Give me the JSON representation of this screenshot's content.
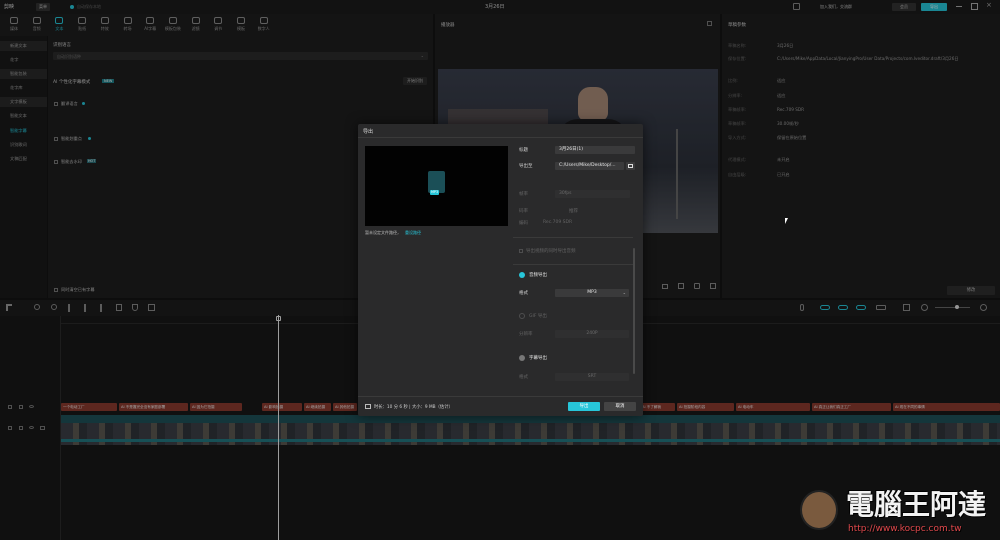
{
  "titlebar": {
    "app_name": "剪映",
    "menu_label": "菜单",
    "autosave": "自动保存本地",
    "project_title": "3月26日",
    "join_prompt": "加入我们，交流群",
    "account_label": "会员",
    "export_label": "导出"
  },
  "toolbar": {
    "items": [
      {
        "label": "媒体",
        "icon": "media-icon"
      },
      {
        "label": "音频",
        "icon": "audio-icon"
      },
      {
        "label": "文本",
        "icon": "text-icon"
      },
      {
        "label": "贴纸",
        "icon": "sticker-icon"
      },
      {
        "label": "特效",
        "icon": "effects-icon"
      },
      {
        "label": "转场",
        "icon": "transition-icon"
      },
      {
        "label": "AI字幕",
        "icon": "caption-icon"
      },
      {
        "label": "模板包装",
        "icon": "template-icon"
      },
      {
        "label": "滤镜",
        "icon": "filter-icon"
      },
      {
        "label": "调节",
        "icon": "adjust-icon"
      },
      {
        "label": "模板",
        "icon": "templates-icon"
      },
      {
        "label": "数字人",
        "icon": "avatar-icon"
      }
    ],
    "active_index": 2
  },
  "sidebar": {
    "items": [
      "新建文本",
      "花字",
      "智能包装",
      "花字库",
      "文字模板",
      "智能文本",
      "智能字幕",
      "识别歌词",
      "文稿匹配"
    ],
    "selected_index": 6
  },
  "caption_panel": {
    "header": "识别语言",
    "language_value": "自动识别语种",
    "ai_mode_label": "AI 个性化字幕模式",
    "ai_badge": "NEW",
    "option_1": "翻译语言",
    "option_2": "智能划重点",
    "option_3": "智能去水印",
    "option_3_badge": "HOT",
    "bottom_option": "同时清空已有字幕",
    "right_button": "开始识别"
  },
  "player": {
    "header": "播放器"
  },
  "details": {
    "header": "草稿参数",
    "rows": [
      {
        "label": "草稿名称:",
        "value": "3月26日"
      },
      {
        "label": "保存位置:",
        "value": "C:/Users/Mike/AppData/Local/JianyingPro/User Data/Projects/com.lveditor.draft/3月26日"
      },
      {
        "label": "比例:",
        "value": "适应"
      },
      {
        "label": "分辨率:",
        "value": "适应"
      },
      {
        "label": "草稿帧率:",
        "value": "Rec.709 SDR"
      },
      {
        "label": "草稿帧率:",
        "value": "30.00帧/秒"
      },
      {
        "label": "导入方式:",
        "value": "保留在原始位置"
      },
      {
        "label": "代理模式:",
        "value": "未开启"
      },
      {
        "label": "自由层级:",
        "value": "已开启"
      }
    ],
    "edit_button": "修改"
  },
  "timeline": {
    "text_clips": [
      "一个电动工厂",
      "AI 不是靠完全没有家庭部署",
      "AI 因为它拍摄",
      "AI 影响拍摄",
      "AI 继续拍摄",
      "AI 其他拍摄",
      "AI 不了解我",
      "AI 拍摄阶段内容",
      "AI 电动车",
      "AI 真正让我们真正工厂",
      "AI 现在不同的事情"
    ]
  },
  "export_dialog": {
    "title": "导出",
    "preview_caption": "暂未设定文件路径，",
    "preview_link": "重设路径",
    "file_badge": "MP3",
    "name_label": "标题",
    "name_value": "3月26日(1)",
    "path_label": "导出至",
    "path_value": "C:/Users/Mike/Desktop/...",
    "video_rows": [
      {
        "label": "帧率",
        "value": "30fps"
      },
      {
        "label": "码率",
        "value": "推荐"
      },
      {
        "label": "编码",
        "value": "Rec.709 SDR"
      }
    ],
    "hdr_label": "导出视频的同时导出音频",
    "audio_export_label": "音频导出",
    "audio_format_label": "格式",
    "audio_format_value": "MP3",
    "gif_export_label": "GIF 导出",
    "gif_res_label": "分辨率",
    "gif_res_value": "240P",
    "subtitle_export_label": "字幕导出",
    "subtitle_format_label": "格式",
    "subtitle_format_value": "SRT",
    "footer_info": "时长：10 分 6 秒 | 大小：9 MB（估计）",
    "export_button": "导出",
    "cancel_button": "取消"
  },
  "watermark": {
    "title": "電腦王阿達",
    "url": "http://www.kocpc.com.tw"
  },
  "colors": {
    "accent": "#27c6d9",
    "text_clip": "#8a3a2f",
    "video_clip": "#1f5f66"
  }
}
